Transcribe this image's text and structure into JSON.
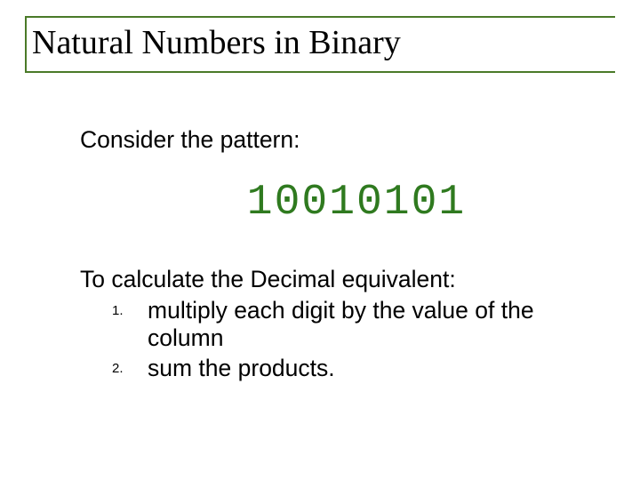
{
  "title": "Natural Numbers in Binary",
  "lead": "Consider the pattern:",
  "binary_value": "10010101",
  "calc_lead": "To calculate the Decimal equivalent:",
  "steps": [
    {
      "num": "1.",
      "text": "multiply each digit by the value of the column"
    },
    {
      "num": "2.",
      "text": "sum the products."
    }
  ],
  "colors": {
    "accent": "#4a7a28",
    "binary": "#2f7a1f"
  }
}
